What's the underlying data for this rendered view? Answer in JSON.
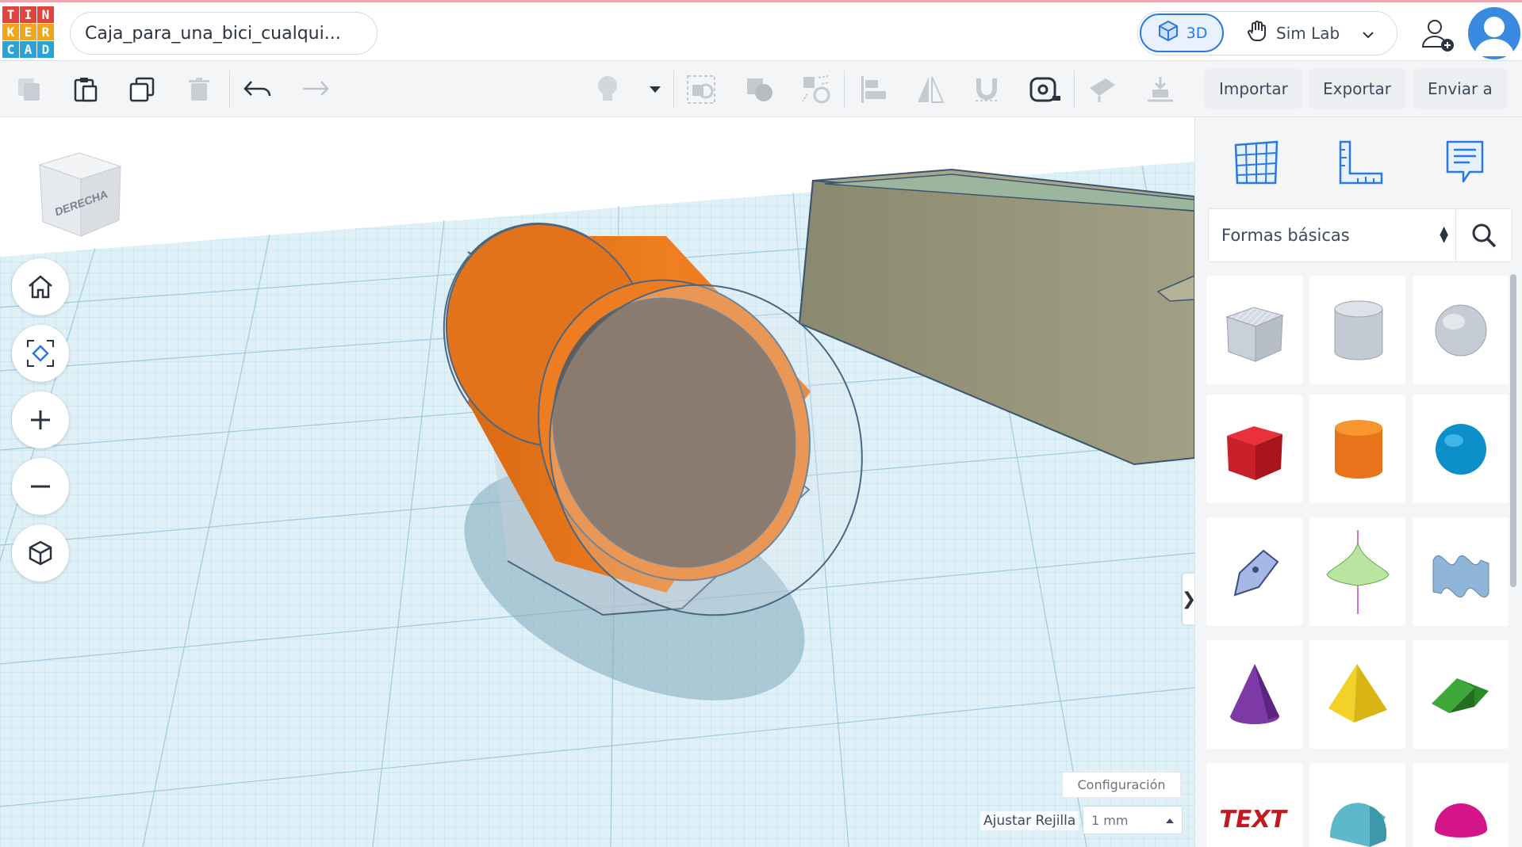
{
  "header": {
    "logo_letters": [
      "T",
      "I",
      "N",
      "K",
      "E",
      "R",
      "C",
      "A",
      "D"
    ],
    "logo_colors": [
      "#e0443d",
      "#e0443d",
      "#e0443d",
      "#f0a51f",
      "#f0a51f",
      "#f0a51f",
      "#2aa3d8",
      "#2aa3d8",
      "#2aa3d8"
    ],
    "doc_title": "Caja_para_una_bici_cualqui...",
    "mode_3d_label": "3D",
    "simlab_label": "Sim Lab"
  },
  "toolbar": {
    "import_label": "Importar",
    "export_label": "Exportar",
    "send_label": "Enviar a"
  },
  "viewport": {
    "viewcube_face": "DERECHA",
    "settings_label": "Configuración",
    "snap_label": "Ajustar Rejilla",
    "snap_value": "1 mm"
  },
  "panel": {
    "category_value": "Formas básicas",
    "shapes": [
      "box-hole",
      "cylinder-hole",
      "sphere-hole",
      "box",
      "cylinder",
      "sphere",
      "scribble",
      "paraboloid",
      "shape-generator",
      "cone",
      "pyramid",
      "roof",
      "text",
      "half-cylinder",
      "half-sphere"
    ]
  },
  "colors": {
    "accent": "#2a79e0",
    "orange_cylinder": "#ea7b1f",
    "box_model": "#8e8d72",
    "grid_bg": "#d9eef6"
  }
}
